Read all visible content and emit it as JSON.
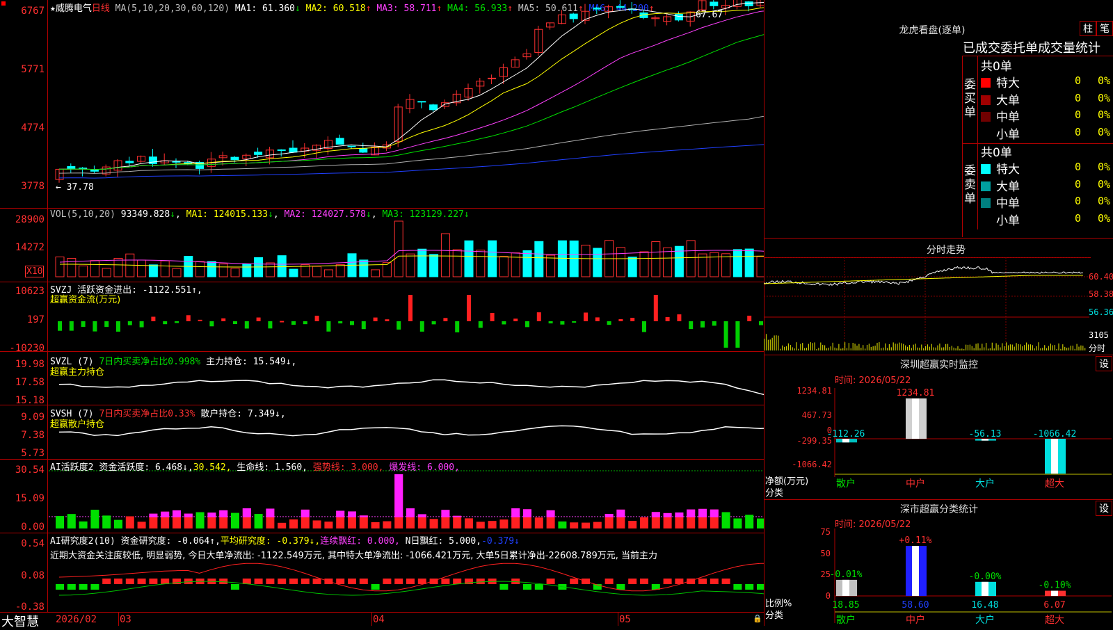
{
  "stock": {
    "name": "★威腾电气",
    "period": "日线"
  },
  "ma_header": {
    "spec": "MA(5,10,20,30,60,120)",
    "items": [
      {
        "label": "MA1:",
        "value": "61.360",
        "arrow": "↓",
        "color": "#ffffff"
      },
      {
        "label": "MA2:",
        "value": "60.518",
        "arrow": "↑",
        "color": "#ffff00"
      },
      {
        "label": "MA3:",
        "value": "58.711",
        "arrow": "↑",
        "color": "#ff40ff"
      },
      {
        "label": "MA4:",
        "value": "56.933",
        "arrow": "↑",
        "color": "#00e000"
      },
      {
        "label": "MA5:",
        "value": "50.611",
        "arrow": "↑",
        "color": "#c0c0c0"
      },
      {
        "label": "MA6:",
        "value": "44.200",
        "arrow": "↑",
        "color": "#2040ff"
      }
    ]
  },
  "main_chart": {
    "y_labels": [
      "6767",
      "5771",
      "4774",
      "3778"
    ],
    "high_label": "67.67",
    "low_label": "37.78",
    "x_labels": [
      "2026/02",
      "03",
      "04",
      "05"
    ]
  },
  "vol_panel": {
    "header": "VOL(5,10,20)",
    "value": "93349.828",
    "value_arrow": "↓",
    "ma1": "MA1: 124015.133",
    "ma1_arrow": "↓",
    "ma2": "MA2: 124027.578",
    "ma2_arrow": "↓",
    "ma3": "MA3: 123129.227",
    "ma3_arrow": "↓",
    "y_labels": [
      "28900",
      "14272"
    ],
    "unit": "X10"
  },
  "svzj_panel": {
    "name": "SVZJ",
    "label": "活跃资金进出: -1122.551↑,",
    "title": "超赢资金流(万元)",
    "y_labels": [
      "10623",
      "197",
      "-10230"
    ]
  },
  "svzl_panel": {
    "name": "SVZL (7)",
    "metric": "7日内买卖净占比0.998%",
    "hold": "主力持仓: 15.549↓,",
    "title": "超赢主力持仓",
    "y_labels": [
      "19.98",
      "17.58",
      "15.18"
    ]
  },
  "svsh_panel": {
    "name": "SVSH (7)",
    "metric": "7日内买卖净占比0.33%",
    "hold": "散户持仓: 7.349↓,",
    "title": "超赢散户持仓",
    "y_labels": [
      "9.09",
      "7.38",
      "5.73"
    ]
  },
  "ai_active_panel": {
    "name": "AI活跃度2",
    "a": "资金活跃度: 6.468↓,",
    "b": "30.542,",
    "c": "生命线: 1.560,",
    "d": "强势线: 3.000,",
    "e": "爆发线: 6.000,",
    "y_labels": [
      "30.54",
      "15.09",
      "0.00"
    ]
  },
  "ai_research_panel": {
    "name": "AI研究度2(10)",
    "a": "资金研究度: -0.064↑,",
    "b": "平均研究度: -0.379↓,",
    "c": "连续飘红: 0.000,",
    "d": "N日飘红: 5.000,",
    "e": "-0.379↓",
    "comment": "近期大资金关注度较低, 明显弱势, 今日大单净流出: -1122.549万元, 其中特大单净流出: -1066.421万元, 大单5日累计净出-22608.789万元, 当前主力",
    "y_labels": [
      "0.54",
      "0.08",
      "-0.38"
    ]
  },
  "footer": {
    "brand": "大智慧",
    "lock": "🔒"
  },
  "dragon_tiger": {
    "title": "龙虎看盘(逐单)",
    "btn_column": "柱",
    "btn_pen": "笔",
    "subtitle": "已成交委托单成交量统计",
    "buy": {
      "label": "委买单",
      "total": "共0单",
      "rows": [
        {
          "name": "特大",
          "value": "0",
          "pct": "0%",
          "color": "#ff0000"
        },
        {
          "name": "大单",
          "value": "0",
          "pct": "0%",
          "color": "#a00000"
        },
        {
          "name": "中单",
          "value": "0",
          "pct": "0%",
          "color": "#700000"
        },
        {
          "name": "小单",
          "value": "0",
          "pct": "0%",
          "color": "#000000"
        }
      ]
    },
    "sell": {
      "label": "委卖单",
      "total": "共0单",
      "rows": [
        {
          "name": "特大",
          "value": "0",
          "pct": "0%",
          "color": "#00ffff"
        },
        {
          "name": "大单",
          "value": "0",
          "pct": "0%",
          "color": "#00a0a0"
        },
        {
          "name": "中单",
          "value": "0",
          "pct": "0%",
          "color": "#008080"
        },
        {
          "name": "小单",
          "value": "0",
          "pct": "0%",
          "color": "#000000"
        }
      ]
    }
  },
  "intraday": {
    "title": "分时走势",
    "y_labels": [
      "60.40",
      "58.38",
      "56.36"
    ],
    "vol_label": "3105",
    "unit": "分时"
  },
  "sz_monitor": {
    "title": "深圳超赢实时监控",
    "btn": "设",
    "time": "时间: 2026/05/22",
    "y_labels": [
      "1234.81",
      "467.73",
      "0",
      "-299.35",
      "-1066.42"
    ],
    "axis_title": "净额(万元)",
    "axis_sub": "分类",
    "categories": [
      "散户",
      "中户",
      "大户",
      "超大"
    ],
    "values": [
      -112.26,
      1234.81,
      -56.13,
      -1066.42
    ],
    "value_labels": [
      "-112.26",
      "1234.81",
      "-56.13",
      "-1066.42"
    ]
  },
  "sz_class": {
    "title": "深市超赢分类统计",
    "btn": "设",
    "time": "时间: 2026/05/22",
    "y_labels": [
      "75",
      "50",
      "25",
      "0"
    ],
    "axis_title": "比例%",
    "axis_sub": "分类",
    "categories": [
      "散户",
      "中户",
      "大户",
      "超大"
    ],
    "values": [
      18.85,
      58.6,
      16.48,
      6.07
    ],
    "value_labels": [
      "18.85",
      "58.60",
      "16.48",
      "6.07"
    ],
    "change_labels": [
      "-0.01%",
      "+0.11%",
      "-0.00%",
      "-0.10%"
    ]
  }
}
